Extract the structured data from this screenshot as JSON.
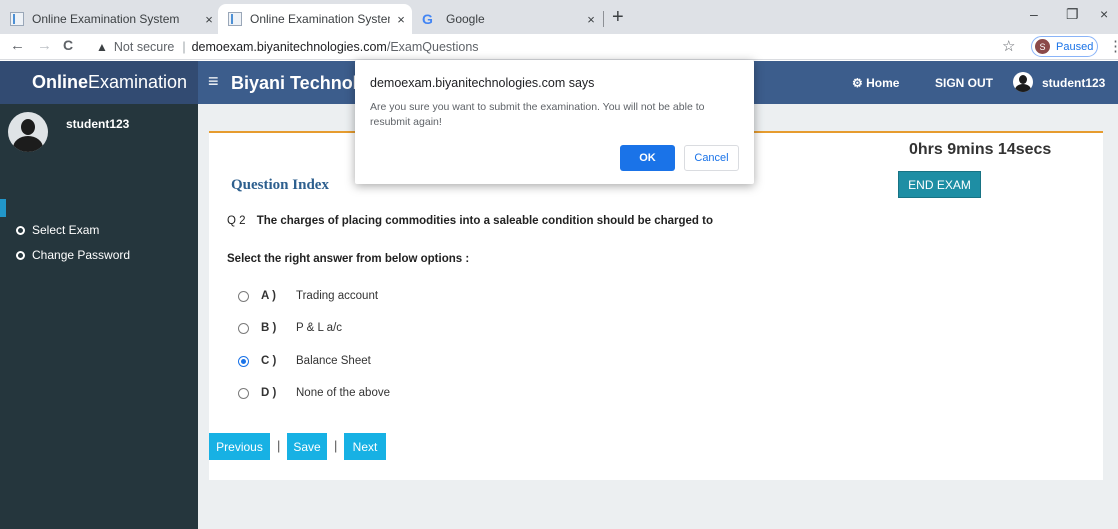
{
  "browser": {
    "tabs": [
      {
        "title": "Online Examination System",
        "close": "×"
      },
      {
        "title": "Online Examination System",
        "close": "×"
      },
      {
        "title": "Google",
        "close": "×",
        "favicon": "G"
      }
    ],
    "new_tab": "+",
    "window_controls": {
      "minimize": "–",
      "restore": "❐",
      "close": "×"
    },
    "nav": {
      "back": "←",
      "forward": "→",
      "reload": "C"
    },
    "address": {
      "security_icon": "▲",
      "security_label": "Not secure",
      "host": "demoexam.biyanitechnologies.com",
      "path": "/ExamQuestions"
    },
    "star": "☆",
    "profile": {
      "initial": "S",
      "status": "Paused"
    },
    "menu": "⋮"
  },
  "app": {
    "brand_bold": "Online",
    "brand_rest": "Examination",
    "menu_icon": "≡",
    "company": "Biyani Technologies",
    "nav_home_icon": "⚙",
    "nav_home": "Home",
    "nav_signout": "SIGN OUT",
    "nav_user": "student123"
  },
  "sidebar": {
    "username": "student123",
    "items": [
      {
        "label": "Select Exam"
      },
      {
        "label": "Change Password"
      }
    ]
  },
  "exam": {
    "timer": "0hrs 9mins 14secs",
    "question_index_label": "Question Index",
    "end_exam_label": "END EXAM",
    "question_number": "Q 2",
    "question_text": "The charges of placing commodities into a saleable condition should be charged to",
    "instruction": "Select the right answer from below options :",
    "options": [
      {
        "letter": "A )",
        "text": "Trading account",
        "selected": false
      },
      {
        "letter": "B )",
        "text": "P & L a/c",
        "selected": false
      },
      {
        "letter": "C )",
        "text": "Balance Sheet",
        "selected": true
      },
      {
        "letter": "D )",
        "text": "None of the above",
        "selected": false
      }
    ],
    "buttons": {
      "previous": "Previous",
      "save": "Save",
      "next": "Next",
      "separator": "|"
    }
  },
  "dialog": {
    "title": "demoexam.biyanitechnologies.com says",
    "message": "Are you sure you want to submit the examination. You will not be able to resubmit again!",
    "ok": "OK",
    "cancel": "Cancel"
  },
  "colors": {
    "brand_bg": "#324b72",
    "topnav_bg": "#3c5d8c",
    "sidebar_bg": "#25363d",
    "accent_orange": "#e69c2f",
    "end_exam_bg": "#1e8ea4",
    "nav_button_bg": "#17b1e4",
    "dialog_primary": "#1a73e8"
  }
}
